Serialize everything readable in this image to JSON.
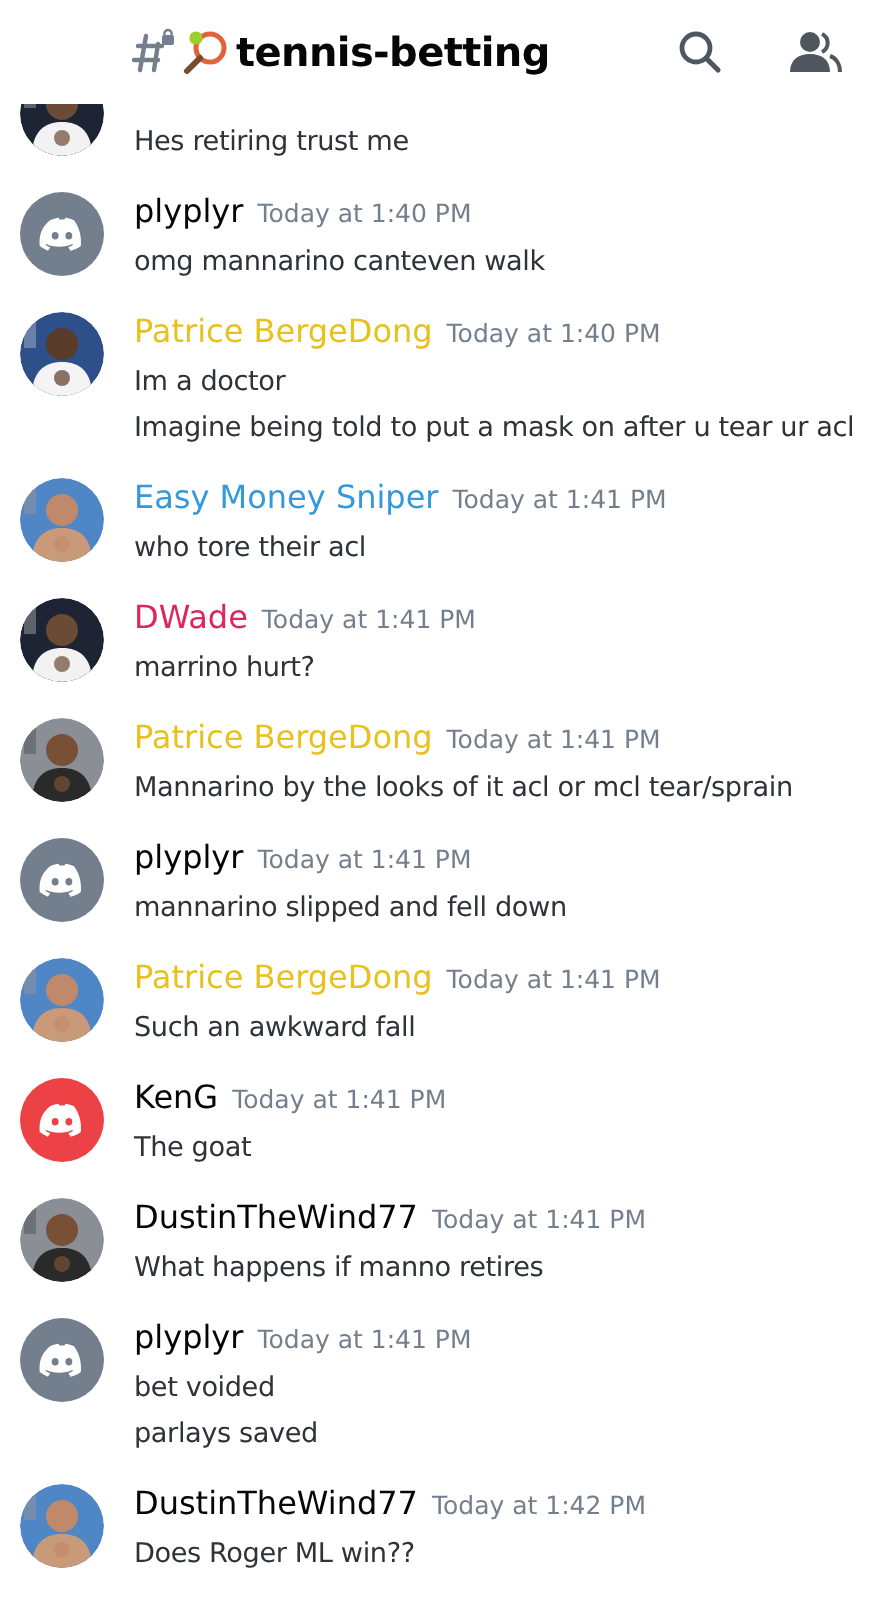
{
  "header": {
    "title": "tennis-betting"
  },
  "messages": [
    {
      "avatar": {
        "kind": "picture"
      },
      "lines": [
        "Hes retiring trust me"
      ]
    },
    {
      "avatar": {
        "kind": "default",
        "color": "#747f8d"
      },
      "author": {
        "name": "plyplyr",
        "color": "#060607"
      },
      "time": "Today at 1:40 PM",
      "lines": [
        "omg mannarino canteven walk"
      ]
    },
    {
      "avatar": {
        "kind": "picture"
      },
      "author": {
        "name": "Patrice BergeDong",
        "color": "#e8c11c"
      },
      "time": "Today at 1:40 PM",
      "lines": [
        "Im a doctor",
        "Imagine being told to put a mask on after u tear ur acl"
      ]
    },
    {
      "avatar": {
        "kind": "picture"
      },
      "author": {
        "name": "Easy Money Sniper",
        "color": "#3498db"
      },
      "time": "Today at 1:41 PM",
      "lines": [
        "who tore their acl"
      ]
    },
    {
      "avatar": {
        "kind": "picture"
      },
      "author": {
        "name": "DWade",
        "color": "#e0245e"
      },
      "time": "Today at 1:41 PM",
      "lines": [
        "marrino hurt?"
      ]
    },
    {
      "avatar": {
        "kind": "picture"
      },
      "author": {
        "name": "Patrice BergeDong",
        "color": "#e8c11c"
      },
      "time": "Today at 1:41 PM",
      "lines": [
        "Mannarino by the looks of it acl or mcl tear/sprain"
      ]
    },
    {
      "avatar": {
        "kind": "default",
        "color": "#747f8d"
      },
      "author": {
        "name": "plyplyr",
        "color": "#060607"
      },
      "time": "Today at 1:41 PM",
      "lines": [
        "mannarino slipped and fell down"
      ]
    },
    {
      "avatar": {
        "kind": "picture"
      },
      "author": {
        "name": "Patrice BergeDong",
        "color": "#e8c11c"
      },
      "time": "Today at 1:41 PM",
      "lines": [
        "Such an awkward fall"
      ]
    },
    {
      "avatar": {
        "kind": "default",
        "color": "#ed4245"
      },
      "author": {
        "name": "KenG",
        "color": "#060607"
      },
      "time": "Today at 1:41 PM",
      "lines": [
        "The goat"
      ]
    },
    {
      "avatar": {
        "kind": "picture"
      },
      "author": {
        "name": "DustinTheWind77",
        "color": "#060607"
      },
      "time": "Today at 1:41 PM",
      "lines": [
        "What happens if manno retires"
      ]
    },
    {
      "avatar": {
        "kind": "default",
        "color": "#747f8d"
      },
      "author": {
        "name": "plyplyr",
        "color": "#060607"
      },
      "time": "Today at 1:41 PM",
      "lines": [
        "bet voided",
        "parlays saved"
      ]
    },
    {
      "avatar": {
        "kind": "picture"
      },
      "author": {
        "name": "DustinTheWind77",
        "color": "#060607"
      },
      "time": "Today at 1:42 PM",
      "lines": [
        "Does Roger ML win??"
      ]
    }
  ]
}
